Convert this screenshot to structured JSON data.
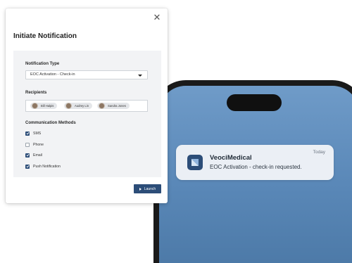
{
  "modal": {
    "title": "Initiate Notification",
    "notification_type": {
      "label": "Notification Type",
      "selected": "EOC Activation - Check-in"
    },
    "recipients": {
      "label": "Recipients",
      "chips": [
        "Bill Halpis",
        "Audrey Lin",
        "Sandra Jones"
      ]
    },
    "communication_methods": {
      "label": "Communication Methods",
      "options": [
        {
          "label": "SMS",
          "checked": true
        },
        {
          "label": "Phone",
          "checked": false
        },
        {
          "label": "Email",
          "checked": true
        },
        {
          "label": "Push Notification",
          "checked": true
        }
      ]
    },
    "launch_label": "Launch",
    "close_icon": "close-icon"
  },
  "phone_notification": {
    "app_name": "VeociMedical",
    "message": "EOC Activation - check-in requested.",
    "time": "Today",
    "app_icon": "veoci-logo-icon"
  },
  "colors": {
    "accent": "#2c4d78",
    "panel_bg": "#f2f3f5",
    "phone_screen": "#5a88b8"
  }
}
